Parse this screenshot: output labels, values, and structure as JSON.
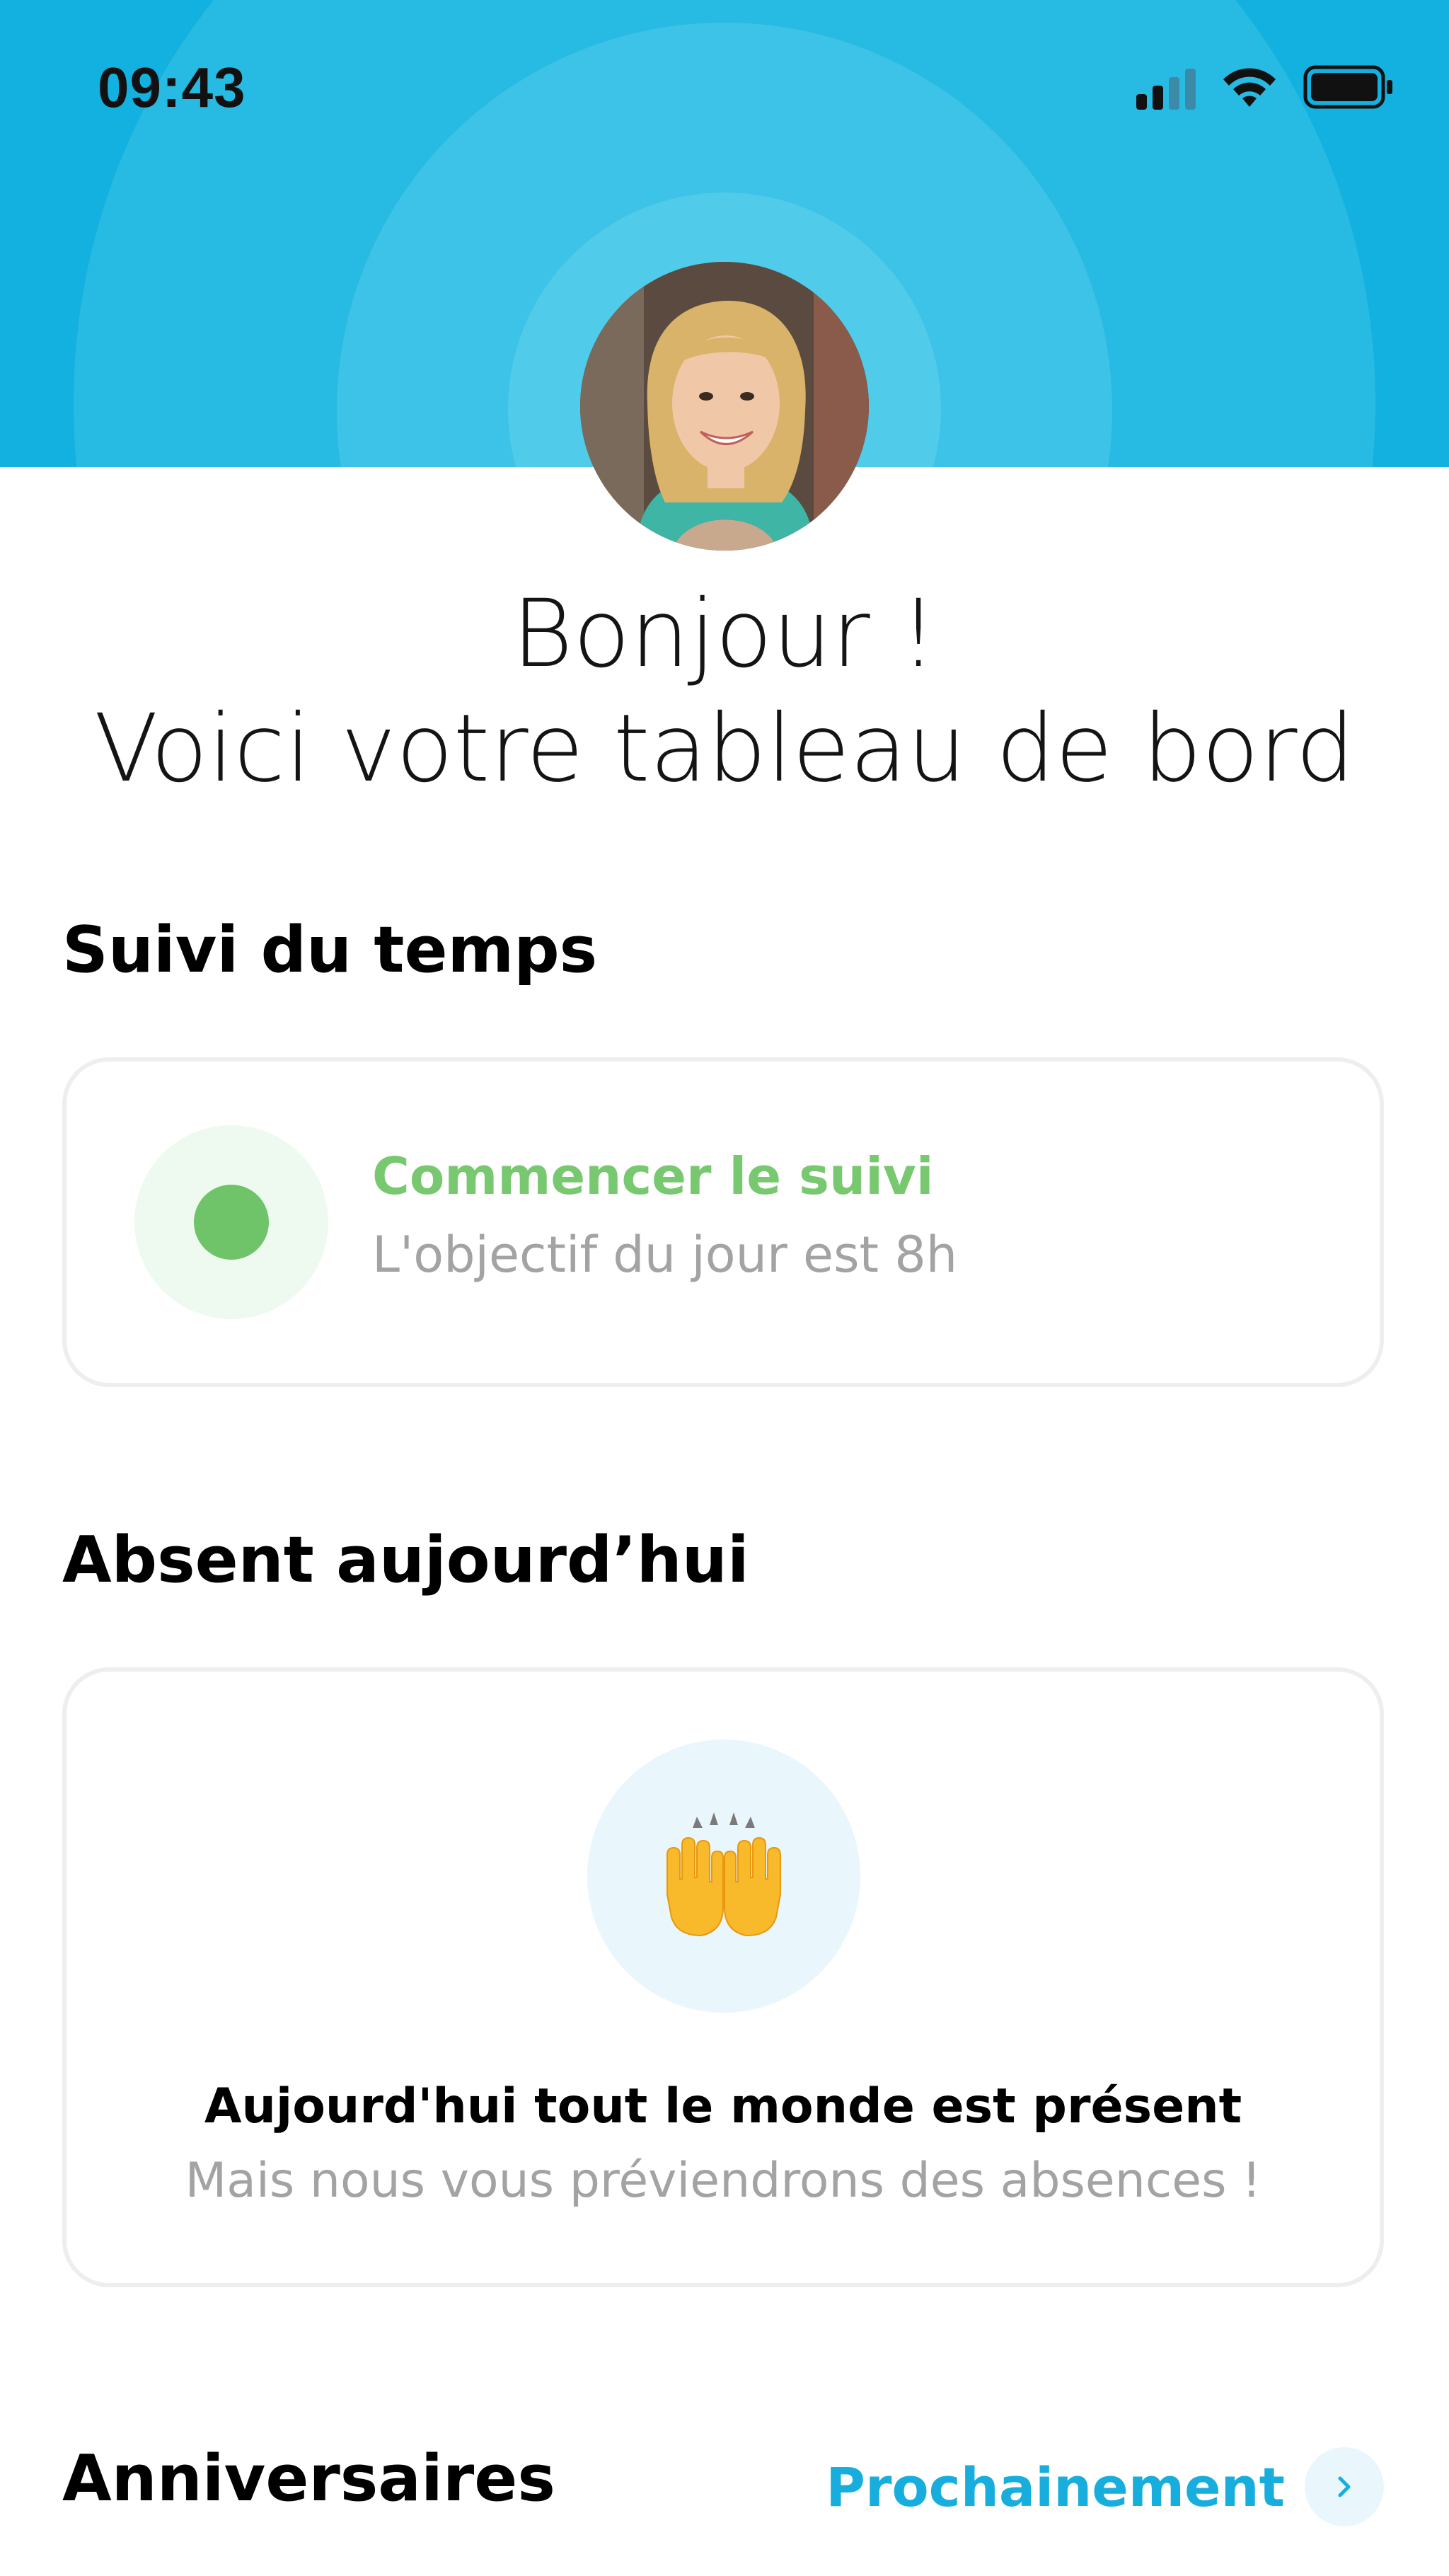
{
  "status_bar": {
    "time": "09:43"
  },
  "header": {
    "color": "#12b1df",
    "avatar_icon": "user-avatar-photo"
  },
  "greeting": {
    "line1": "Bonjour !",
    "line2": "Voici votre tableau de bord"
  },
  "time_tracking": {
    "title": "Suivi du temps",
    "action": "Commencer le suivi",
    "subtitle": "L'objectif du jour est 8h",
    "accent": "#6fc369"
  },
  "absences": {
    "title": "Absent aujourd’hui",
    "emoji_icon": "raising-hands-icon",
    "message": "Aujourd'hui tout le monde est présent",
    "submessage": "Mais nous vous préviendrons des absences !"
  },
  "birthdays": {
    "title": "Anniversaires",
    "link": "Prochainement",
    "link_color": "#17aedd"
  }
}
